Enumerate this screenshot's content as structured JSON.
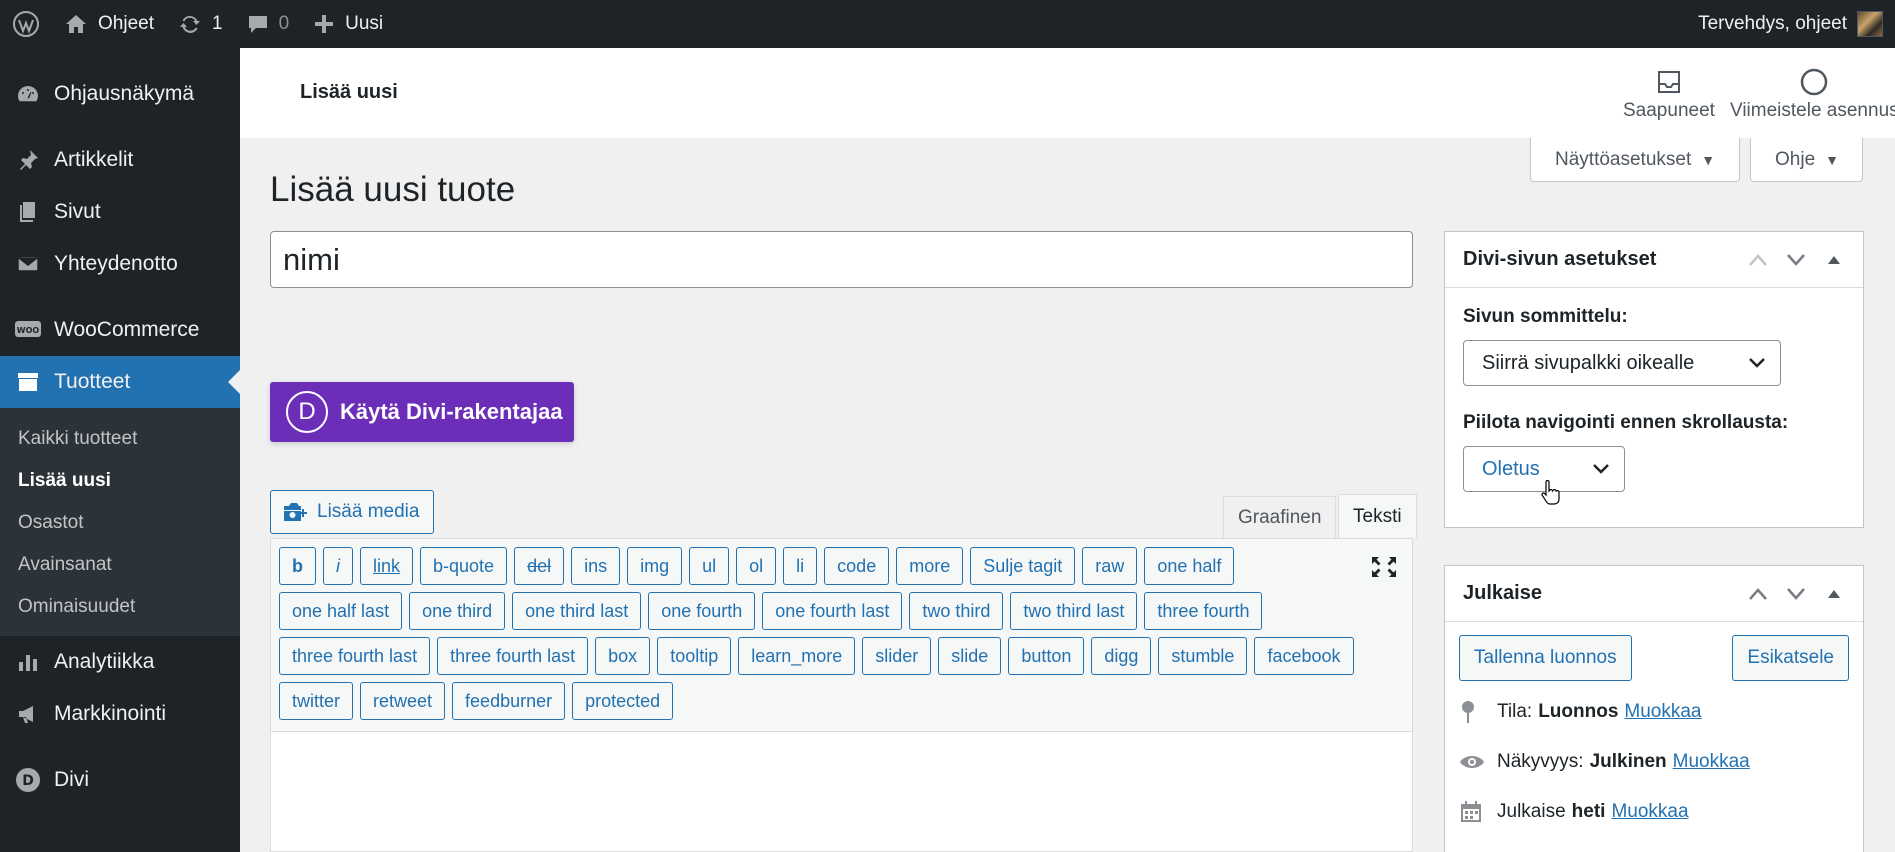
{
  "adminbar": {
    "site_name": "Ohjeet",
    "updates_count": "1",
    "comments_count": "0",
    "new_label": "Uusi",
    "greeting": "Tervehdys, ohjeet"
  },
  "sidebar": {
    "items": [
      {
        "label": "Ohjausnäkymä",
        "icon": "dashboard-icon"
      },
      {
        "label": "Artikkelit",
        "icon": "pushpin-icon"
      },
      {
        "label": "Sivut",
        "icon": "pages-icon"
      },
      {
        "label": "Yhteydenotto",
        "icon": "mail-icon"
      },
      {
        "label": "WooCommerce",
        "icon": "woo-icon"
      },
      {
        "label": "Tuotteet",
        "icon": "archive-icon"
      },
      {
        "label": "Analytiikka",
        "icon": "chart-icon"
      },
      {
        "label": "Markkinointi",
        "icon": "megaphone-icon"
      },
      {
        "label": "Divi",
        "icon": "divi-icon"
      }
    ],
    "submenu": [
      "Kaikki tuotteet",
      "Lisää uusi",
      "Osastot",
      "Avainsanat",
      "Ominaisuudet"
    ]
  },
  "header": {
    "title": "Lisää uusi",
    "inbox_label": "Saapuneet",
    "setup_label": "Viimeistele asennus"
  },
  "screen_options": {
    "screen_label": "Näyttöasetukset",
    "help_label": "Ohje"
  },
  "page": {
    "heading": "Lisää uusi tuote",
    "title_value": "nimi"
  },
  "divi_button": {
    "logo": "D",
    "label": "Käytä Divi-rakentajaa"
  },
  "editor": {
    "add_media": "Lisää media",
    "tab_visual": "Graafinen",
    "tab_text": "Teksti",
    "quicktags": [
      "b",
      "i",
      "link",
      "b-quote",
      "del",
      "ins",
      "img",
      "ul",
      "ol",
      "li",
      "code",
      "more",
      "Sulje tagit",
      "raw",
      "one half",
      "one half last",
      "one third",
      "one third last",
      "one fourth",
      "one fourth last",
      "two third",
      "two third last",
      "three fourth",
      "three fourth last",
      "three fourth last",
      "box",
      "tooltip",
      "learn_more",
      "slider",
      "slide",
      "button",
      "digg",
      "stumble",
      "facebook",
      "twitter",
      "retweet",
      "feedburner",
      "protected"
    ]
  },
  "divi_settings": {
    "title": "Divi-sivun asetukset",
    "layout_label": "Sivun sommittelu:",
    "layout_value": "Siirrä sivupalkki oikealle",
    "nav_label": "Piilota navigointi ennen skrollausta:",
    "nav_value": "Oletus"
  },
  "publish": {
    "title": "Julkaise",
    "save_draft": "Tallenna luonnos",
    "preview": "Esikatsele",
    "status_label": "Tila:",
    "status_value": "Luonnos",
    "visibility_label": "Näkyvyys:",
    "visibility_value": "Julkinen",
    "publish_label": "Julkaise",
    "publish_value": "heti",
    "edit_link": "Muokkaa"
  }
}
